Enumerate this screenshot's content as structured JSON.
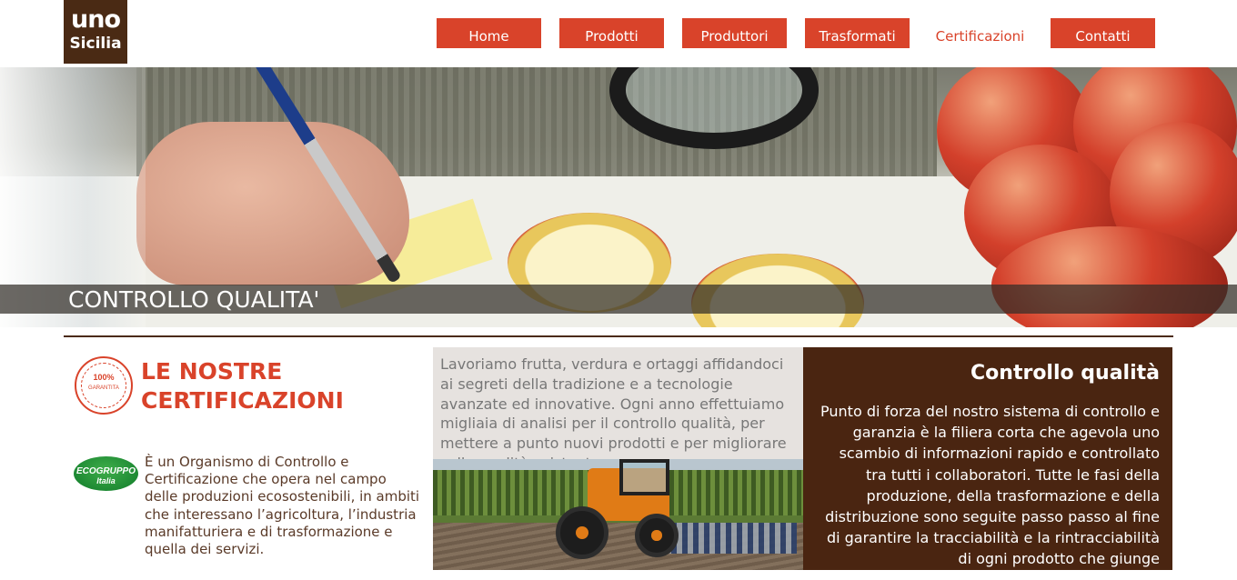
{
  "logo": {
    "line1": "uno",
    "line2": "Sicilia"
  },
  "nav": {
    "items": [
      {
        "label": "Home"
      },
      {
        "label": "Prodotti"
      },
      {
        "label": "Produttori"
      },
      {
        "label": "Trasformati"
      },
      {
        "label": "Certificazioni"
      },
      {
        "label": "Contatti"
      }
    ],
    "active": "Certificazioni"
  },
  "hero": {
    "title": "CONTROLLO QUALITA'"
  },
  "certifications": {
    "title": "LE NOSTRE CERTIFICAZIONI",
    "badge": {
      "text": "100%",
      "subtext": "GARANTITA"
    },
    "eco_logo": {
      "line1": "ECOGRUPPO",
      "line2": "Italia"
    },
    "eco_description": "È un Organismo di Controllo e Certificazione che opera nel campo delle produzioni ecosostenibili, in ambiti che interessano l’agricoltura, l’industria manifatturiera e di trasformazione e quella dei servizi."
  },
  "middle": {
    "text": "Lavoriamo frutta, verdura e ortaggi affidandoci ai segreti della tradizione e a tecnologie avanzate ed innovative. Ogni anno effettuiamo migliaia di analisi per il controllo qualità, per mettere a punto nuovi prodotti e per migliorare sulla qualità esistente."
  },
  "quality": {
    "title": "Controllo qualità",
    "text": "Punto di forza del nostro sistema di controllo e garanzia è la filiera corta che agevola uno scambio di informazioni rapido e controllato tra tutti i collaboratori. Tutte le fasi della produzione, della trasformazione e della distribuzione sono seguite passo passo al fine di garantire la tracciabilità e la rintracciabilità di ogni prodotto che giunge"
  },
  "colors": {
    "accent": "#d9432a",
    "brand_brown": "#4a2511",
    "nav_text": "#ffffff"
  }
}
